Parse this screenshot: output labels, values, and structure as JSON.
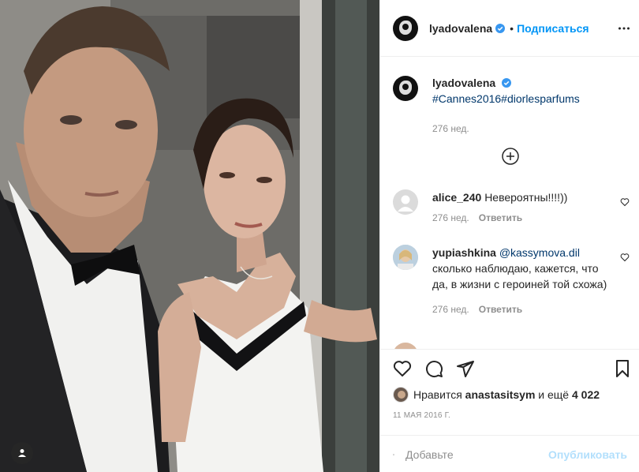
{
  "post": {
    "author": {
      "username": "lyadovalena",
      "verified": true
    },
    "header": {
      "follow_label": "Подписаться",
      "separator": "•"
    },
    "caption": {
      "username": "lyadovalena",
      "hashtags": "#Cannes2016#diorlesparfums",
      "age": "276 нед."
    },
    "comments": [
      {
        "username": "alice_240",
        "text": "Невероятны!!!!))",
        "age": "276 нед.",
        "reply_label": "Ответить"
      },
      {
        "username": "yupiashkina",
        "mention": "@kassymova.dil",
        "text": "сколько наблюдаю, кажется, что да, в жизни с героиней той схожа)",
        "age": "276 нед.",
        "reply_label": "Ответить"
      }
    ],
    "likes": {
      "prefix": "Нравится",
      "user": "anastasitsym",
      "suffix": "и ещё",
      "count": "4 022"
    },
    "date": "11 мая 2016 г.",
    "comment_box": {
      "placeholder": "Добавьте",
      "publish_label": "Опубликовать"
    }
  },
  "colors": {
    "accent": "#0095f6",
    "verified": "#3897f0",
    "publish_disabled": "#b2dffc"
  }
}
